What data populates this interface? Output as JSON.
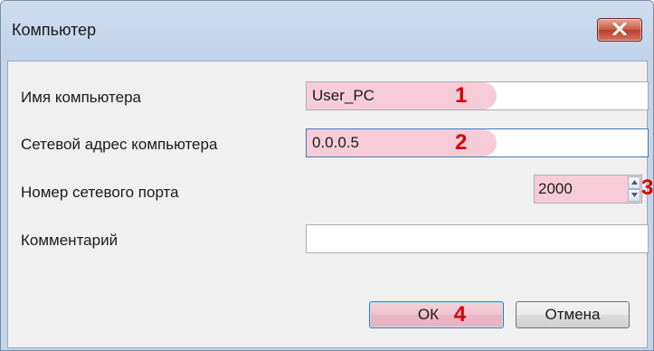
{
  "window": {
    "title": "Компьютер",
    "close_label": "Закрыть"
  },
  "form": {
    "computer_name": {
      "label": "Имя компьютера",
      "value": "User_PC",
      "marker": "1"
    },
    "network_address": {
      "label": "Сетевой адрес компьютера",
      "value": "0.0.0.5",
      "marker": "2"
    },
    "network_port": {
      "label": "Номер сетевого порта",
      "value": "2000",
      "marker": "3"
    },
    "comment": {
      "label": "Комментарий",
      "value": ""
    }
  },
  "buttons": {
    "ok_label": "ОК",
    "ok_marker": "4",
    "cancel_label": "Отмена"
  },
  "colors": {
    "highlight": "#f7ccd8",
    "marker": "#d60000",
    "titlebar": "#c4d5ea"
  }
}
